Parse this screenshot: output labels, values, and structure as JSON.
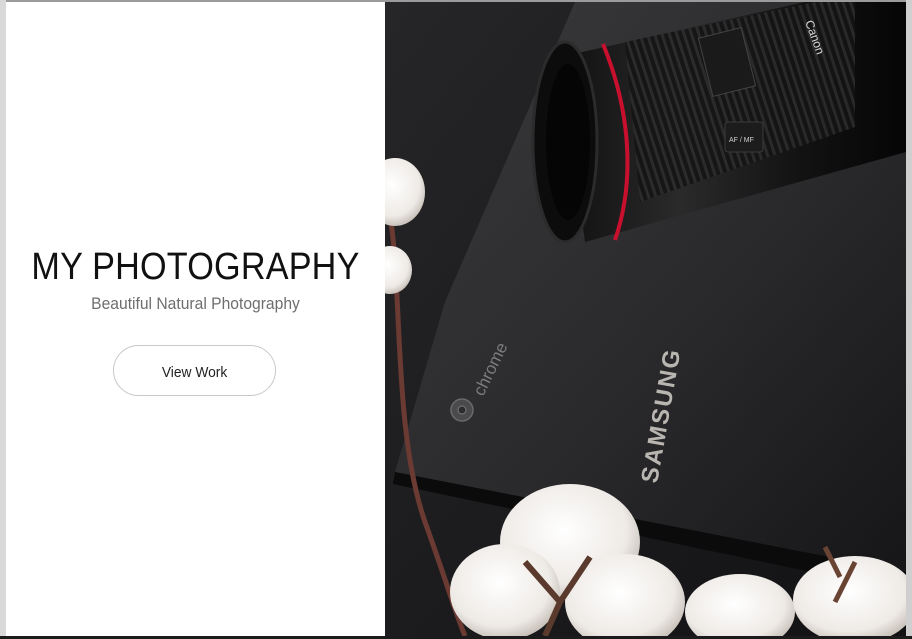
{
  "hero": {
    "title": "MY PHOTOGRAPHY",
    "subtitle": "Beautiful Natural Photography",
    "cta_label": "View Work"
  },
  "photo": {
    "laptop_brand_text": "SAMSUNG",
    "laptop_logo_text": "chrome",
    "lens_brand_text": "Canon",
    "lens_spec_text": "AF / MF"
  },
  "colors": {
    "page_bg": "#ffffff",
    "title": "#111111",
    "subtitle": "#6e6e6e",
    "button_border": "#c9c9c9",
    "photo_bg": "#1d1d1f",
    "lens_ring": "#c8102e"
  }
}
